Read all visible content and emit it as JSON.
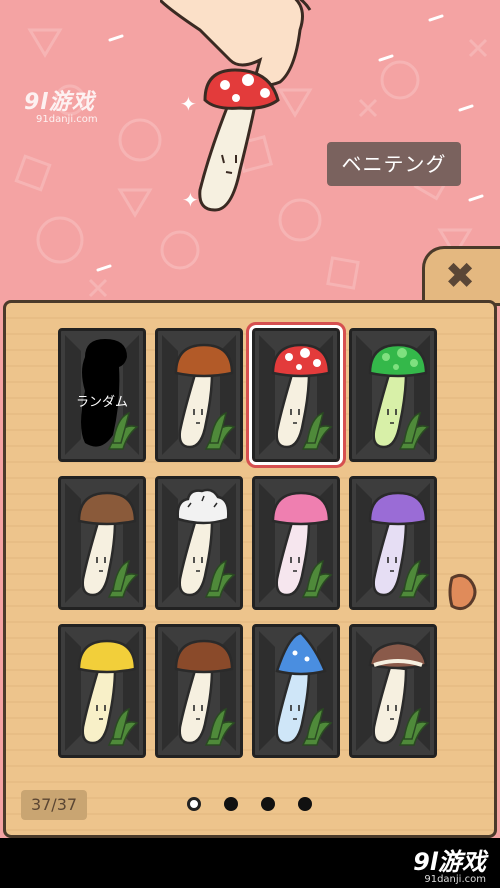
{
  "header": {
    "selected_name": "ベニテング"
  },
  "watermark": {
    "logo": "9l游戏",
    "site": "91danji.com"
  },
  "collection": {
    "random_label": "ランダム",
    "counter": "37/37",
    "items": [
      {
        "name": "random",
        "cap": "#000000",
        "cap_style": "silhouette"
      },
      {
        "name": "brown",
        "cap": "#b25a28",
        "cap_style": "plain"
      },
      {
        "name": "beniteng",
        "cap": "#e33b3b",
        "cap_style": "spots",
        "selected": true
      },
      {
        "name": "green",
        "cap": "#34b84a",
        "cap_style": "spots-light",
        "stem": "#d8f0a8"
      },
      {
        "name": "cream-brown",
        "cap": "#8a5a3a",
        "cap_style": "plain"
      },
      {
        "name": "white-fluffy",
        "cap": "#f2f2f2",
        "cap_style": "fluffy"
      },
      {
        "name": "pink",
        "cap": "#ef7fb0",
        "cap_style": "plain",
        "stem": "#f6e6ee"
      },
      {
        "name": "purple",
        "cap": "#9a6cd6",
        "cap_style": "plain",
        "stem": "#e6def4"
      },
      {
        "name": "yellow",
        "cap": "#f2cf3a",
        "cap_style": "plain",
        "stem": "#f8f0c8"
      },
      {
        "name": "shiitake",
        "cap": "#8a4a2a",
        "cap_style": "plain"
      },
      {
        "name": "blue",
        "cap": "#4a8ee0",
        "cap_style": "pointy",
        "stem": "#cfe6f8"
      },
      {
        "name": "eringi",
        "cap": "#8a5a4a",
        "cap_style": "flat"
      }
    ]
  },
  "pagination": {
    "pages": 4,
    "current": 1
  },
  "colors": {
    "background": "#f4a3a3",
    "panel": "#edc48c",
    "outline": "#4a3a2a",
    "selected_border": "#d65050"
  },
  "icons": {
    "close": "close-x-icon",
    "next": "arrow-right-icon"
  }
}
